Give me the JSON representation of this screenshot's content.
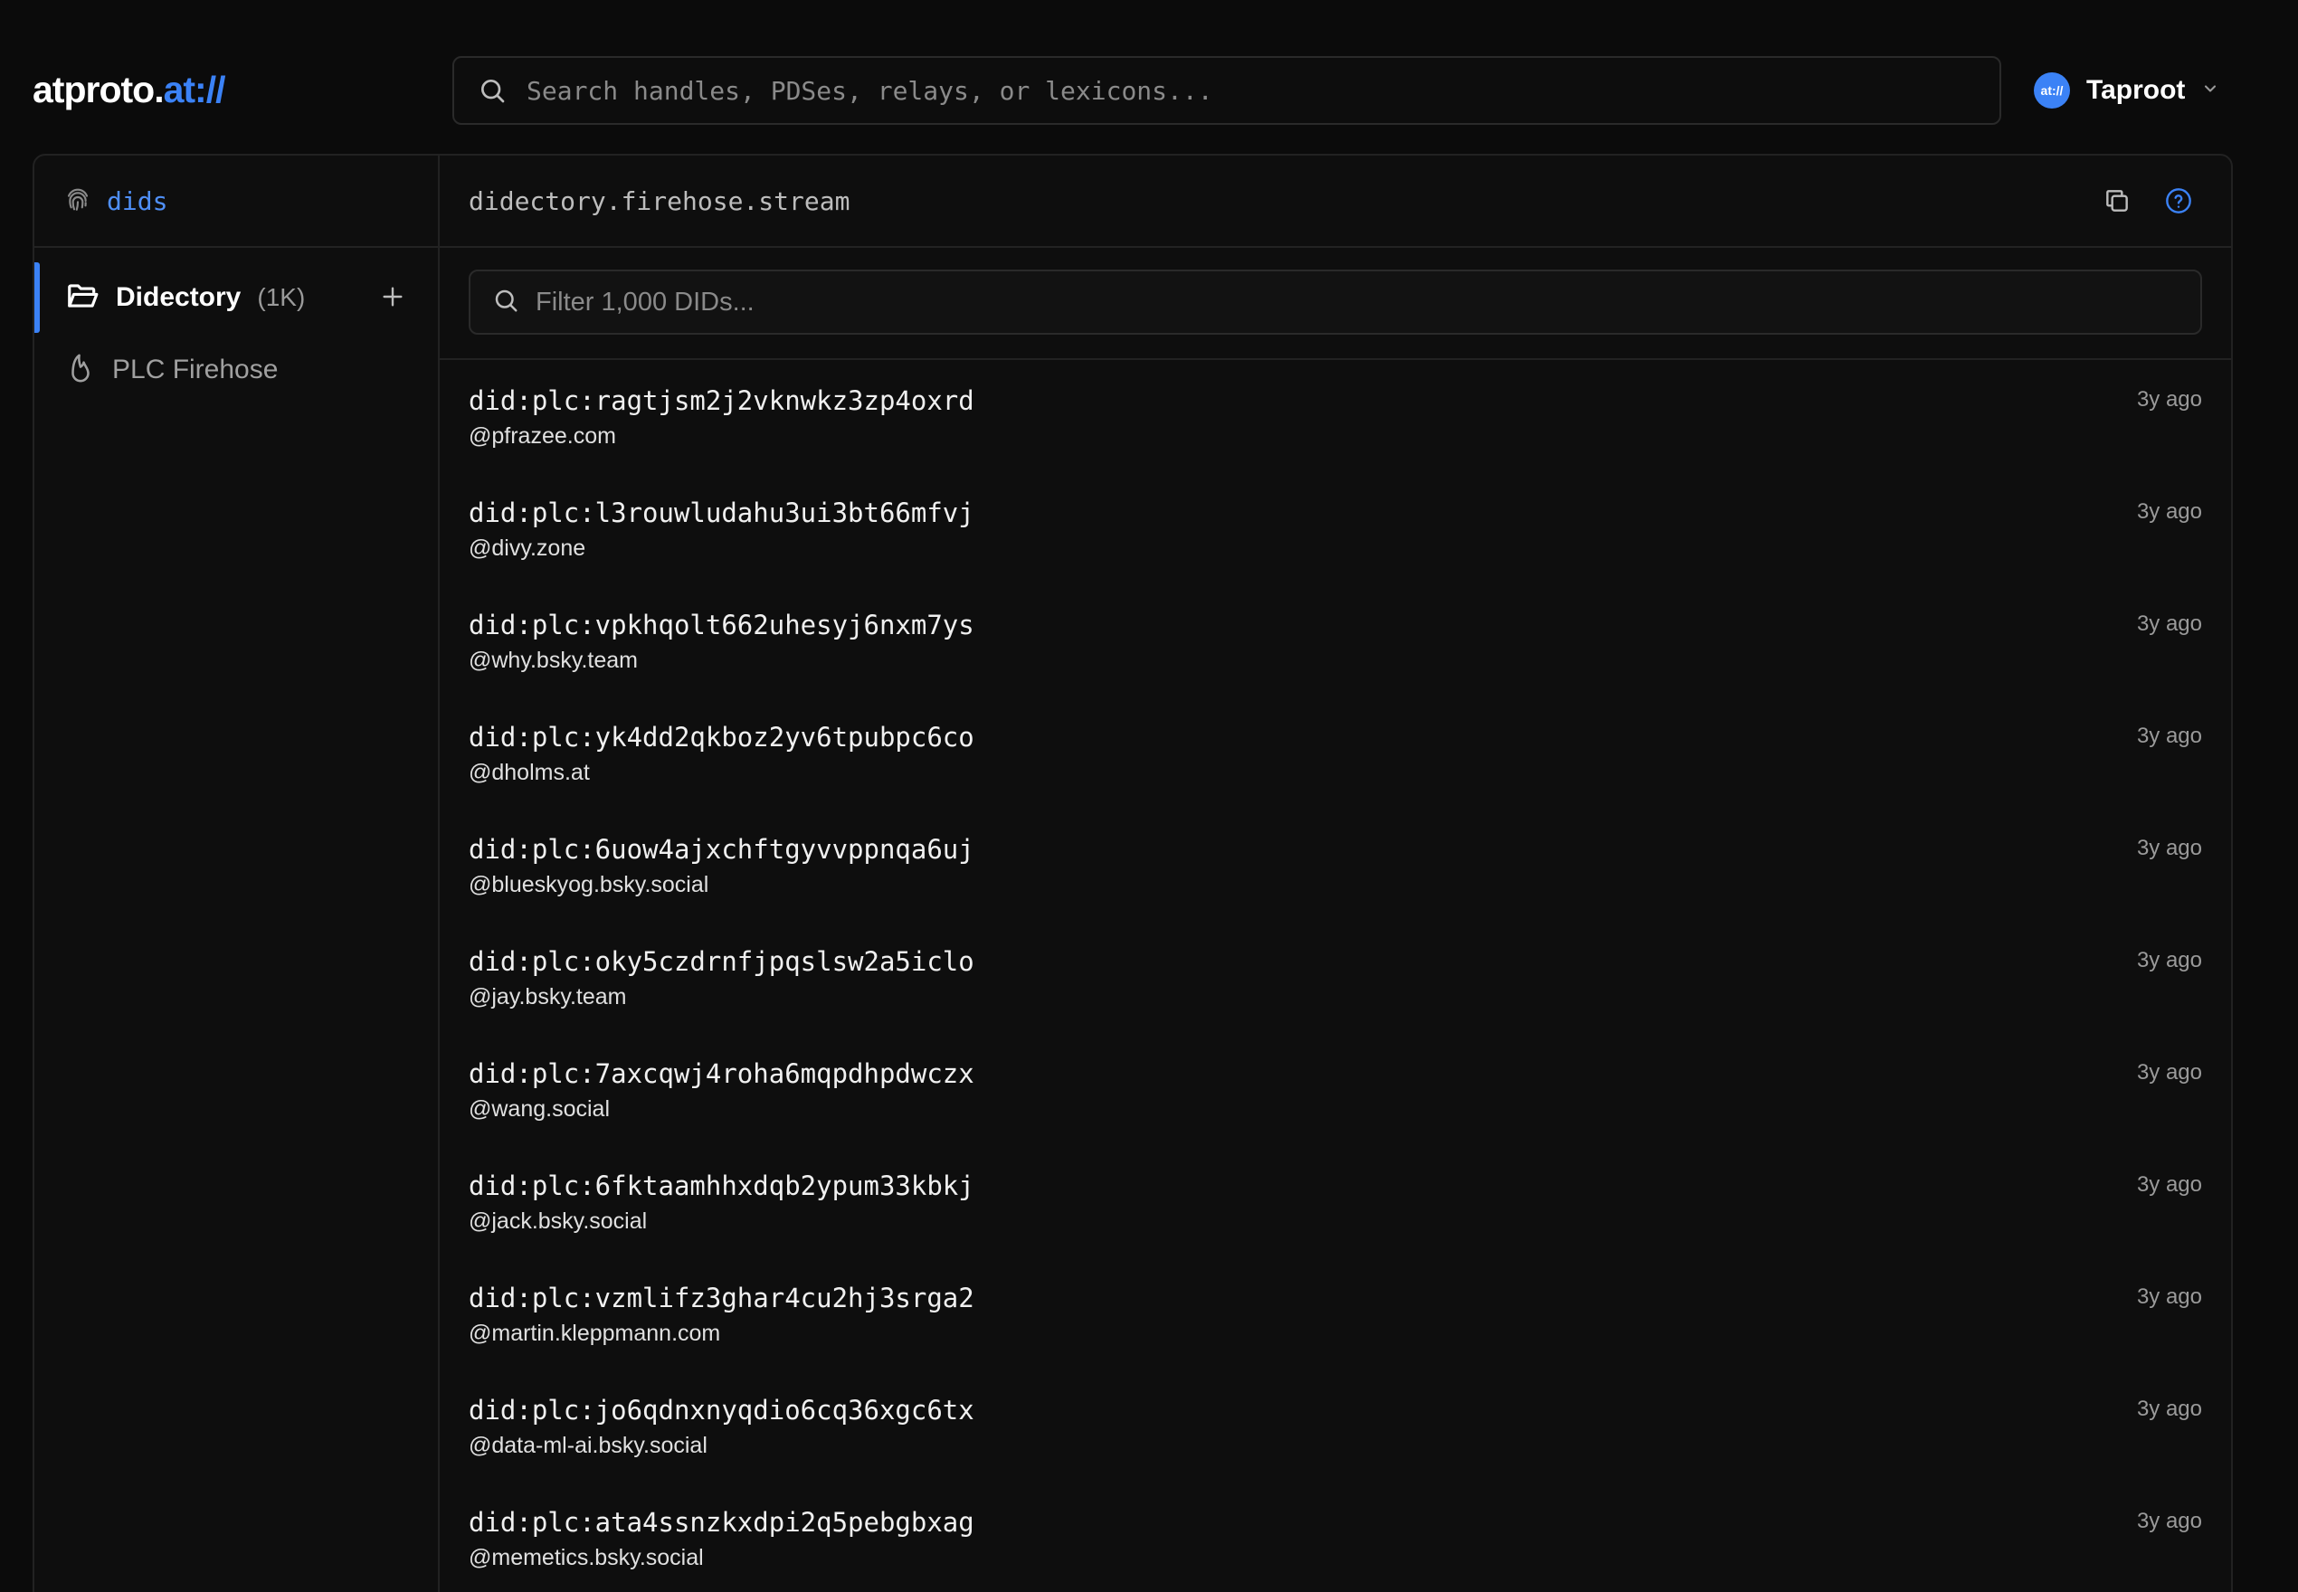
{
  "header": {
    "logo_main": "atproto.",
    "logo_accent": "at://",
    "search_placeholder": "Search handles, PDSes, relays, or lexicons...",
    "account": {
      "avatar_text": "at://",
      "name": "Taproot"
    }
  },
  "sidebar": {
    "section_label": "dids",
    "items": [
      {
        "label": "Didectory",
        "count": "(1K)"
      },
      {
        "label": "PLC Firehose"
      }
    ]
  },
  "content": {
    "title": "didectory.firehose.stream",
    "filter_placeholder": "Filter 1,000 DIDs...",
    "rows": [
      {
        "did": "did:plc:ragtjsm2j2vknwkz3zp4oxrd",
        "handle": "@pfrazee.com",
        "time": "3y ago"
      },
      {
        "did": "did:plc:l3rouwludahu3ui3bt66mfvj",
        "handle": "@divy.zone",
        "time": "3y ago"
      },
      {
        "did": "did:plc:vpkhqolt662uhesyj6nxm7ys",
        "handle": "@why.bsky.team",
        "time": "3y ago"
      },
      {
        "did": "did:plc:yk4dd2qkboz2yv6tpubpc6co",
        "handle": "@dholms.at",
        "time": "3y ago"
      },
      {
        "did": "did:plc:6uow4ajxchftgyvvppnqa6uj",
        "handle": "@blueskyog.bsky.social",
        "time": "3y ago"
      },
      {
        "did": "did:plc:oky5czdrnfjpqslsw2a5iclo",
        "handle": "@jay.bsky.team",
        "time": "3y ago"
      },
      {
        "did": "did:plc:7axcqwj4roha6mqpdhpdwczx",
        "handle": "@wang.social",
        "time": "3y ago"
      },
      {
        "did": "did:plc:6fktaamhhxdqb2ypum33kbkj",
        "handle": "@jack.bsky.social",
        "time": "3y ago"
      },
      {
        "did": "did:plc:vzmlifz3ghar4cu2hj3srga2",
        "handle": "@martin.kleppmann.com",
        "time": "3y ago"
      },
      {
        "did": "did:plc:jo6qdnxnyqdio6cq36xgc6tx",
        "handle": "@data-ml-ai.bsky.social",
        "time": "3y ago"
      },
      {
        "did": "did:plc:ata4ssnzkxdpi2q5pebgbxag",
        "handle": "@memetics.bsky.social",
        "time": "3y ago"
      }
    ]
  },
  "colors": {
    "accent": "#3b82f6",
    "background": "#0b0b0b",
    "border": "#222222"
  }
}
